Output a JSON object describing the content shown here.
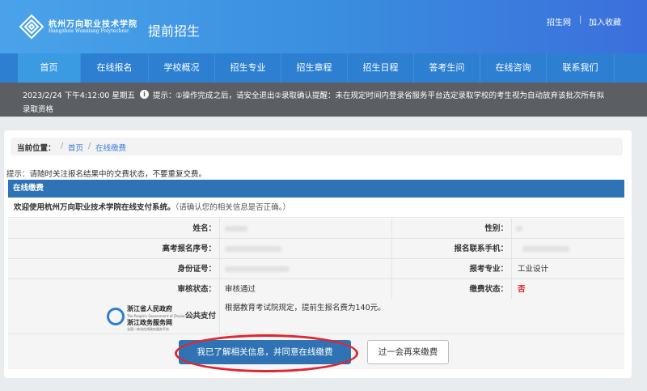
{
  "header": {
    "logo_cn": "杭州万向职业技术学院",
    "logo_en": "Hangzhou Wanxiang Polytechnic",
    "site_title": "提前招生",
    "links": [
      "招生网",
      "加入收藏"
    ]
  },
  "nav": {
    "items": [
      "首页",
      "在线报名",
      "学校概况",
      "招生专业",
      "招生章程",
      "招生日程",
      "答考生问",
      "在线咨询",
      "联系我们"
    ],
    "active": "首页"
  },
  "notice": {
    "datetime": "2023/2/24 下午4:12:00 星期五",
    "label": "提示：",
    "text_line1": "①操作完成之后，请安全退出②录取确认提醒：未在规定时间内登录省服务平台选定录取学校的考生视为自动放弃该批次所有拟",
    "text_line2": "录取资格"
  },
  "breadcrumb": {
    "label": "当前位置：",
    "home": "首页",
    "current": "在线缴费"
  },
  "tip": "提示：请随时关注报名结果中的交费状态，不要重复交费。",
  "section": {
    "title": "在线缴费",
    "welcome_bold": "欢迎使用杭州万向职业技术学院在线支付系统。",
    "welcome_note": "（请确认您的相关信息是否正确。）"
  },
  "info": {
    "name_label": "姓名：",
    "name_value": "",
    "gender_label": "性别：",
    "gender_value": "",
    "exam_no_label": "高考报名序号：",
    "exam_no_value": "",
    "phone_label": "报名联系手机：",
    "phone_value": "",
    "id_label": "身份证号：",
    "id_value": "",
    "major_label": "报考专业：",
    "major_value": "工业设计",
    "review_label": "审核状态：",
    "review_value": "审核通过",
    "pay_status_label": "缴费状态：",
    "pay_status_value": "否"
  },
  "payment": {
    "gov_line1": "浙江省人民政府",
    "gov_line2": "The People's Government of Zhejiang Province",
    "gov_line3": "浙江政务服务网",
    "gov_line4": "全国一体化在线政务服务平台",
    "method_label": "公共支付",
    "fee_text": "根据教育考试院规定，提前生报名费为140元。"
  },
  "buttons": {
    "agree": "我已了解相关信息，并同意在线缴费",
    "later": "过一会再来缴费"
  },
  "colors": {
    "header_blue": "#3a8fdf",
    "nav_blue": "#2d7fd2",
    "section_blue": "#2f73b5",
    "alert_red": "#e0262e"
  }
}
